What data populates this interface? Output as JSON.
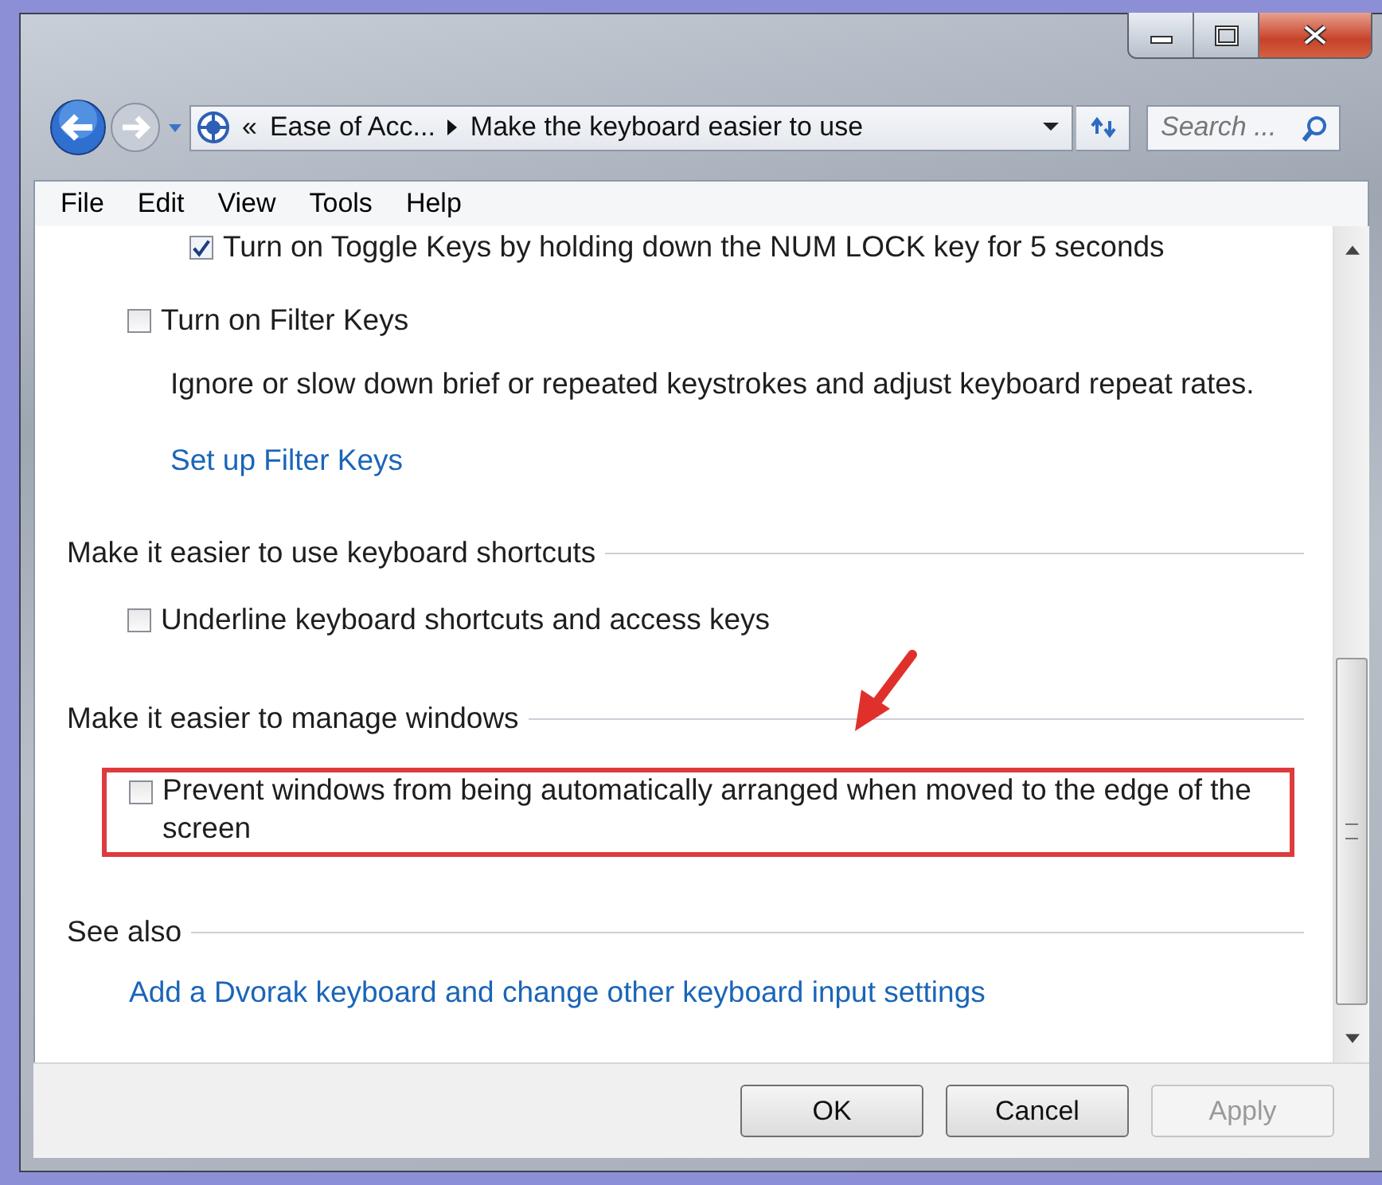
{
  "window": {
    "caption_buttons": [
      {
        "kind": "minimize"
      },
      {
        "kind": "maximize"
      },
      {
        "kind": "close"
      }
    ]
  },
  "address_bar": {
    "overflow": "«",
    "crumbs": [
      "Ease of Acc...",
      "Make the keyboard easier to use"
    ]
  },
  "search": {
    "placeholder": "Search ..."
  },
  "menu": [
    "File",
    "Edit",
    "View",
    "Tools",
    "Help"
  ],
  "content": [
    {
      "kind": "group",
      "children": [
        {
          "kind": "checkbox",
          "label": "Turn on Toggle Keys by holding down the NUM LOCK key for 5 seconds",
          "checked": true,
          "highlighted": false
        }
      ]
    },
    {
      "kind": "checkbox",
      "label": "Turn on Filter Keys",
      "checked": false,
      "highlighted": false,
      "children": [
        {
          "kind": "text",
          "text": "Ignore or slow down brief or repeated keystrokes and adjust keyboard repeat rates."
        },
        {
          "kind": "link",
          "text": "Set up Filter Keys"
        }
      ]
    },
    {
      "kind": "heading",
      "text": "Make it easier to use keyboard shortcuts"
    },
    {
      "kind": "checkbox",
      "label": "Underline keyboard shortcuts and access keys",
      "checked": false,
      "highlighted": false
    },
    {
      "kind": "heading",
      "text": "Make it easier to manage windows"
    },
    {
      "kind": "checkbox",
      "label": "Prevent windows from being automatically arranged when moved to the edge of the screen",
      "checked": false,
      "highlighted": true
    },
    {
      "kind": "heading",
      "text": "See also"
    },
    {
      "kind": "toplink",
      "text": "Add a Dvorak keyboard and change other keyboard input settings"
    }
  ],
  "buttons": [
    {
      "label": "OK",
      "disabled": false
    },
    {
      "label": "Cancel",
      "disabled": false
    },
    {
      "label": "Apply",
      "disabled": true
    }
  ]
}
